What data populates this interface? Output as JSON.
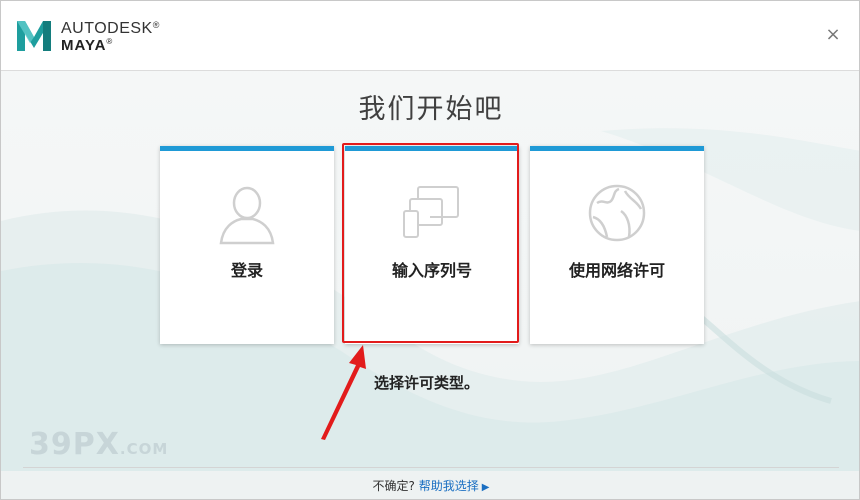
{
  "header": {
    "brand_line1": "AUTODESK",
    "brand_line2": "MAYA",
    "registered_mark": "®",
    "close_symbol": "×"
  },
  "main": {
    "heading": "我们开始吧",
    "cards": [
      {
        "id": "login",
        "label": "登录",
        "icon": "user-icon"
      },
      {
        "id": "serial",
        "label": "输入序列号",
        "icon": "devices-icon"
      },
      {
        "id": "network",
        "label": "使用网络许可",
        "icon": "globe-icon"
      }
    ],
    "hint": "选择许可类型。"
  },
  "footer": {
    "question": "不确定?",
    "help_link": "帮助我选择",
    "link_arrow": "▶"
  },
  "watermark": {
    "main": "39PX",
    "suffix": ".COM"
  },
  "colors": {
    "accent_bar": "#1f9ad6",
    "highlight_box": "#e21b1b",
    "link": "#1a6fc2",
    "logo_teal": "#1e9e9e"
  }
}
